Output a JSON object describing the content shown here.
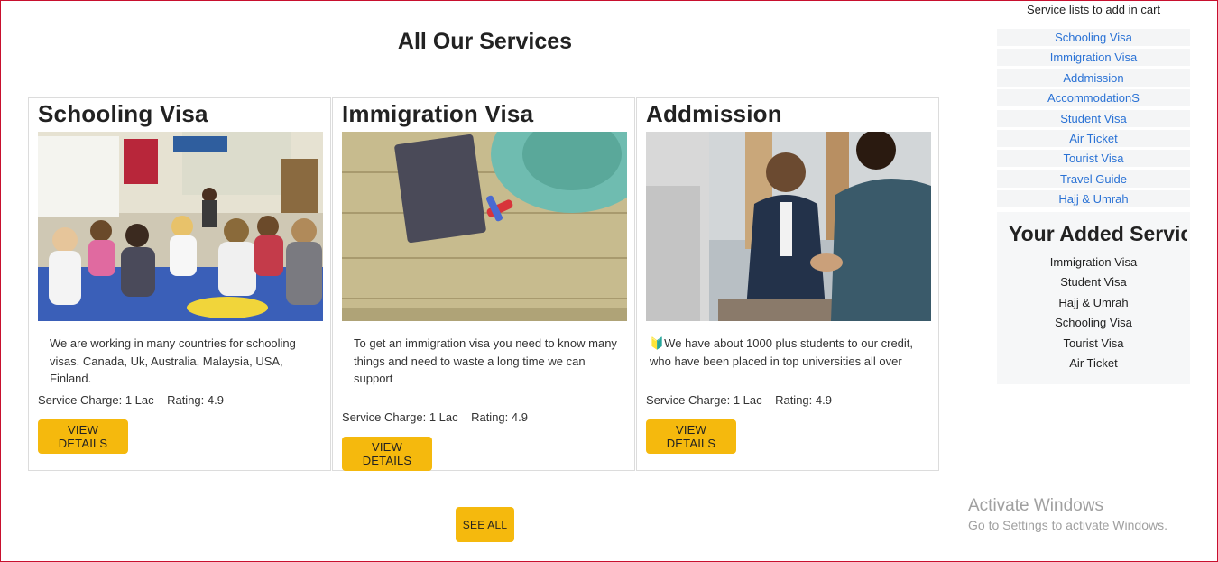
{
  "main": {
    "title": "All Our Services"
  },
  "services": [
    {
      "title": "Schooling Visa",
      "image_icon": "classroom-photo",
      "description": "We are working in many countries for schooling visas. Canada, Uk, Australia, Malaysia, USA, Finland.",
      "charge": "Service Charge: 1 Lac",
      "rating": "Rating: 4.9",
      "button": "VIEW DETAILS"
    },
    {
      "title": "Immigration Visa",
      "image_icon": "passport-photo",
      "description": "To get an immigration visa you need to know many things and need to waste a long time we can support",
      "charge": "Service Charge: 1 Lac",
      "rating": "Rating: 4.9",
      "button": "VIEW DETAILS"
    },
    {
      "title": "Addmission",
      "image_icon": "handshake-photo",
      "description": "🔰We have about 1000 plus students to our credit, who have been placed in top universities all over",
      "charge": "Service Charge: 1 Lac",
      "rating": "Rating: 4.9",
      "button": "VIEW DETAILS"
    }
  ],
  "see_all": "SEE ALL",
  "sidebar": {
    "heading": "Service lists to add in cart",
    "items": [
      "Schooling Visa",
      "Immigration Visa",
      "Addmission",
      "AccommodationS",
      "Student Visa",
      "Air Ticket",
      "Tourist Visa",
      "Travel Guide",
      "Hajj & Umrah"
    ],
    "added_title": "Your Added Servic",
    "added_items": [
      "Immigration Visa",
      "Student Visa",
      "Hajj & Umrah",
      "Schooling Visa",
      "Tourist Visa",
      "Air Ticket"
    ]
  },
  "watermark": {
    "line1": "Activate Windows",
    "line2": "Go to Settings to activate Windows."
  },
  "colors": {
    "button": "#f5b90d",
    "link": "#2a72d5",
    "border": "#c8102e"
  }
}
